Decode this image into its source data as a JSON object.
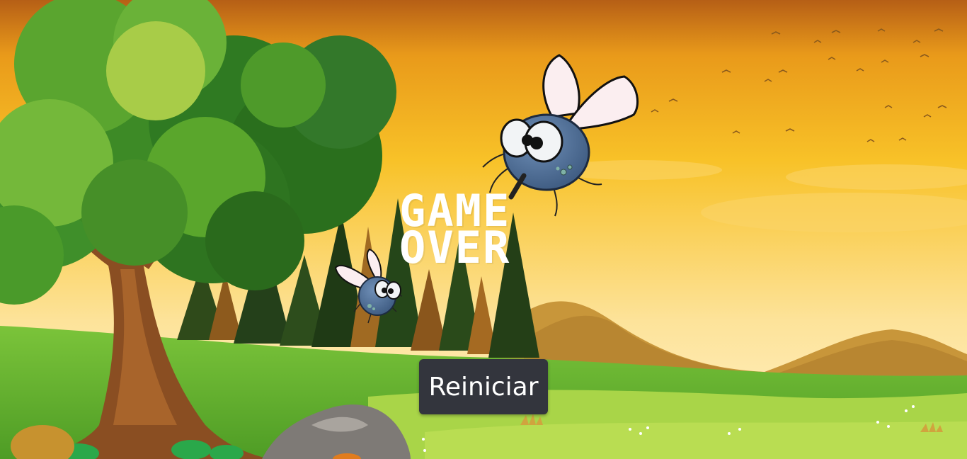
{
  "game": {
    "state_title_line1": "GAME",
    "state_title_line2": "OVER",
    "restart_label": "Reiniciar"
  },
  "sprites": [
    {
      "name": "fly-large",
      "icon": "fly-icon"
    },
    {
      "name": "fly-small",
      "icon": "fly-icon"
    }
  ],
  "colors": {
    "sky_top": "#c96a12",
    "sky_mid": "#f6b91e",
    "sky_low": "#fde9a6",
    "grass": "#62b32e",
    "foliage": "#3f8f2a",
    "fly_body": "#4f6f97",
    "button_bg": "#33353d",
    "button_text": "#ffffff"
  }
}
